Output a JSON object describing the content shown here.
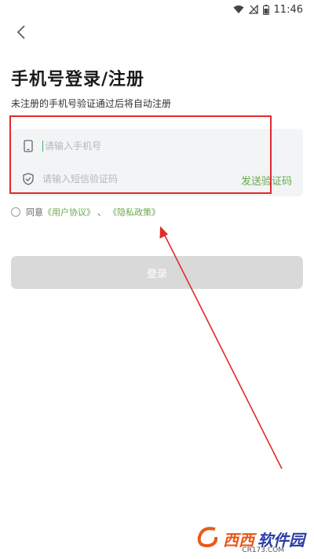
{
  "status_bar": {
    "time": "11:46",
    "icons": [
      "wifi-icon",
      "signal-icon",
      "battery-icon"
    ]
  },
  "header": {
    "back_icon": "chevron-left-icon"
  },
  "page": {
    "title": "手机号登录/注册",
    "subtitle": "未注册的手机号验证通过后将自动注册"
  },
  "form": {
    "phone": {
      "placeholder": "请输入手机号",
      "value": "",
      "icon": "phone-icon"
    },
    "code": {
      "placeholder": "请输入短信验证码",
      "value": "",
      "icon": "shield-icon"
    },
    "send_code_label": "发送验证码"
  },
  "agreement": {
    "prefix": "同意",
    "user_agreement": "《用户协议》",
    "separator": "、",
    "privacy_policy": "《隐私政策》",
    "checked": false
  },
  "login_button": {
    "label": "登录"
  },
  "watermark": {
    "brand_a": "西西",
    "brand_b": "软件园",
    "url": "CR173.COM"
  },
  "colors": {
    "accent_green": "#6aa84f",
    "annotation_red": "#e02b2b",
    "button_disabled": "#d9d9d9",
    "card_bg": "#f3f4f6"
  }
}
